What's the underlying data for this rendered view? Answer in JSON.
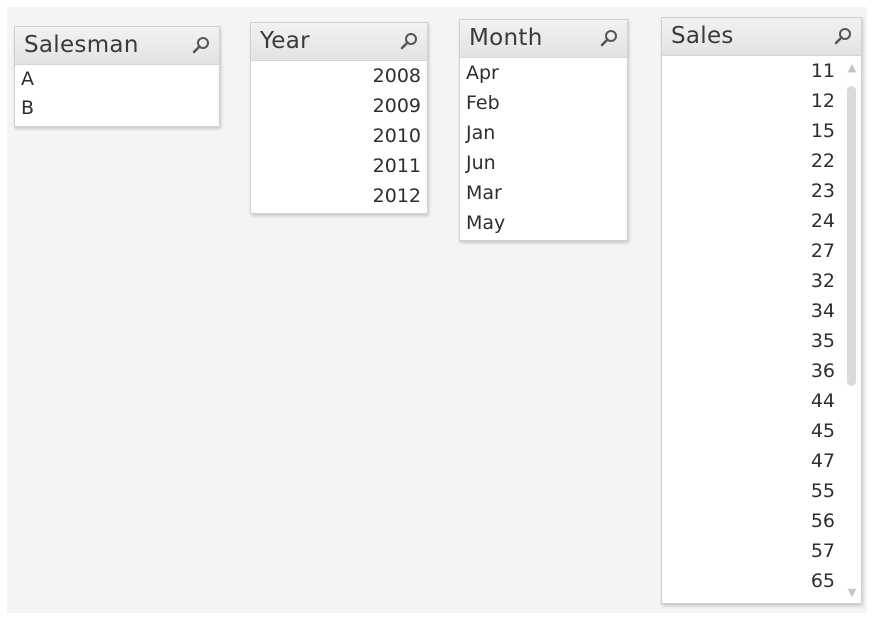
{
  "icons": {
    "search": "search-icon",
    "scroll_up": "scroll-up-arrow-icon",
    "scroll_down": "scroll-down-arrow-icon"
  },
  "salesman": {
    "title": "Salesman",
    "items": [
      "A",
      "B"
    ]
  },
  "year": {
    "title": "Year",
    "items": [
      "2008",
      "2009",
      "2010",
      "2011",
      "2012"
    ]
  },
  "month": {
    "title": "Month",
    "items": [
      "Apr",
      "Feb",
      "Jan",
      "Jun",
      "Mar",
      "May"
    ]
  },
  "sales": {
    "title": "Sales",
    "items": [
      "11",
      "12",
      "15",
      "22",
      "23",
      "24",
      "27",
      "32",
      "34",
      "35",
      "36",
      "44",
      "45",
      "47",
      "55",
      "56",
      "57",
      "65"
    ]
  }
}
